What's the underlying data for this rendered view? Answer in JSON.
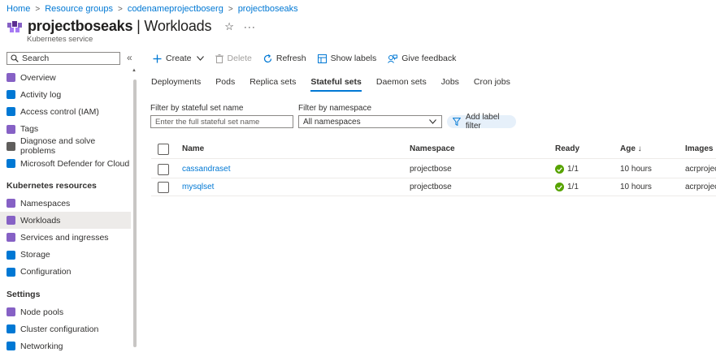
{
  "breadcrumb": [
    "Home",
    "Resource groups",
    "codenameprojectboserg",
    "projectboseaks"
  ],
  "header": {
    "resource_name": "projectboseaks",
    "page_name": "| Workloads",
    "subtitle": "Kubernetes service",
    "star": "☆",
    "more": "···"
  },
  "sidebar": {
    "search_placeholder": "Search",
    "collapse": "«",
    "items_top": [
      {
        "label": "Overview",
        "icon": "overview-icon",
        "color": "#8661c5"
      },
      {
        "label": "Activity log",
        "icon": "activity-log-icon",
        "color": "#0078d4"
      },
      {
        "label": "Access control (IAM)",
        "icon": "iam-icon",
        "color": "#0078d4"
      },
      {
        "label": "Tags",
        "icon": "tag-icon",
        "color": "#8661c5"
      },
      {
        "label": "Diagnose and solve problems",
        "icon": "wrench-icon",
        "color": "#605e5c"
      },
      {
        "label": "Microsoft Defender for Cloud",
        "icon": "shield-icon",
        "color": "#0078d4"
      }
    ],
    "section_kubernetes": "Kubernetes resources",
    "items_k8s": [
      {
        "label": "Namespaces",
        "icon": "namespaces-icon",
        "color": "#8661c5"
      },
      {
        "label": "Workloads",
        "icon": "workloads-icon",
        "color": "#8661c5",
        "active": true
      },
      {
        "label": "Services and ingresses",
        "icon": "services-icon",
        "color": "#8661c5"
      },
      {
        "label": "Storage",
        "icon": "storage-icon",
        "color": "#0078d4"
      },
      {
        "label": "Configuration",
        "icon": "configuration-icon",
        "color": "#0078d4"
      }
    ],
    "section_settings": "Settings",
    "items_settings": [
      {
        "label": "Node pools",
        "icon": "node-pools-icon",
        "color": "#8661c5"
      },
      {
        "label": "Cluster configuration",
        "icon": "cluster-config-icon",
        "color": "#0078d4"
      },
      {
        "label": "Networking",
        "icon": "networking-icon",
        "color": "#0078d4"
      }
    ]
  },
  "toolbar": {
    "create": "Create",
    "delete": "Delete",
    "refresh": "Refresh",
    "show_labels": "Show labels",
    "give_feedback": "Give feedback"
  },
  "tabs": [
    "Deployments",
    "Pods",
    "Replica sets",
    "Stateful sets",
    "Daemon sets",
    "Jobs",
    "Cron jobs"
  ],
  "active_tab": "Stateful sets",
  "filters": {
    "name_label": "Filter by stateful set name",
    "name_placeholder": "Enter the full stateful set name",
    "namespace_label": "Filter by namespace",
    "namespace_value": "All namespaces",
    "add_label_filter": "Add label filter"
  },
  "table": {
    "columns": [
      "Name",
      "Namespace",
      "Ready",
      "Age ↓",
      "Images"
    ],
    "rows": [
      {
        "name": "cassandraset",
        "namespace": "projectbose",
        "ready": "1/1",
        "age": "10 hours",
        "images": "acrproject"
      },
      {
        "name": "mysqlset",
        "namespace": "projectbose",
        "ready": "1/1",
        "age": "10 hours",
        "images": "acrproject"
      }
    ]
  }
}
